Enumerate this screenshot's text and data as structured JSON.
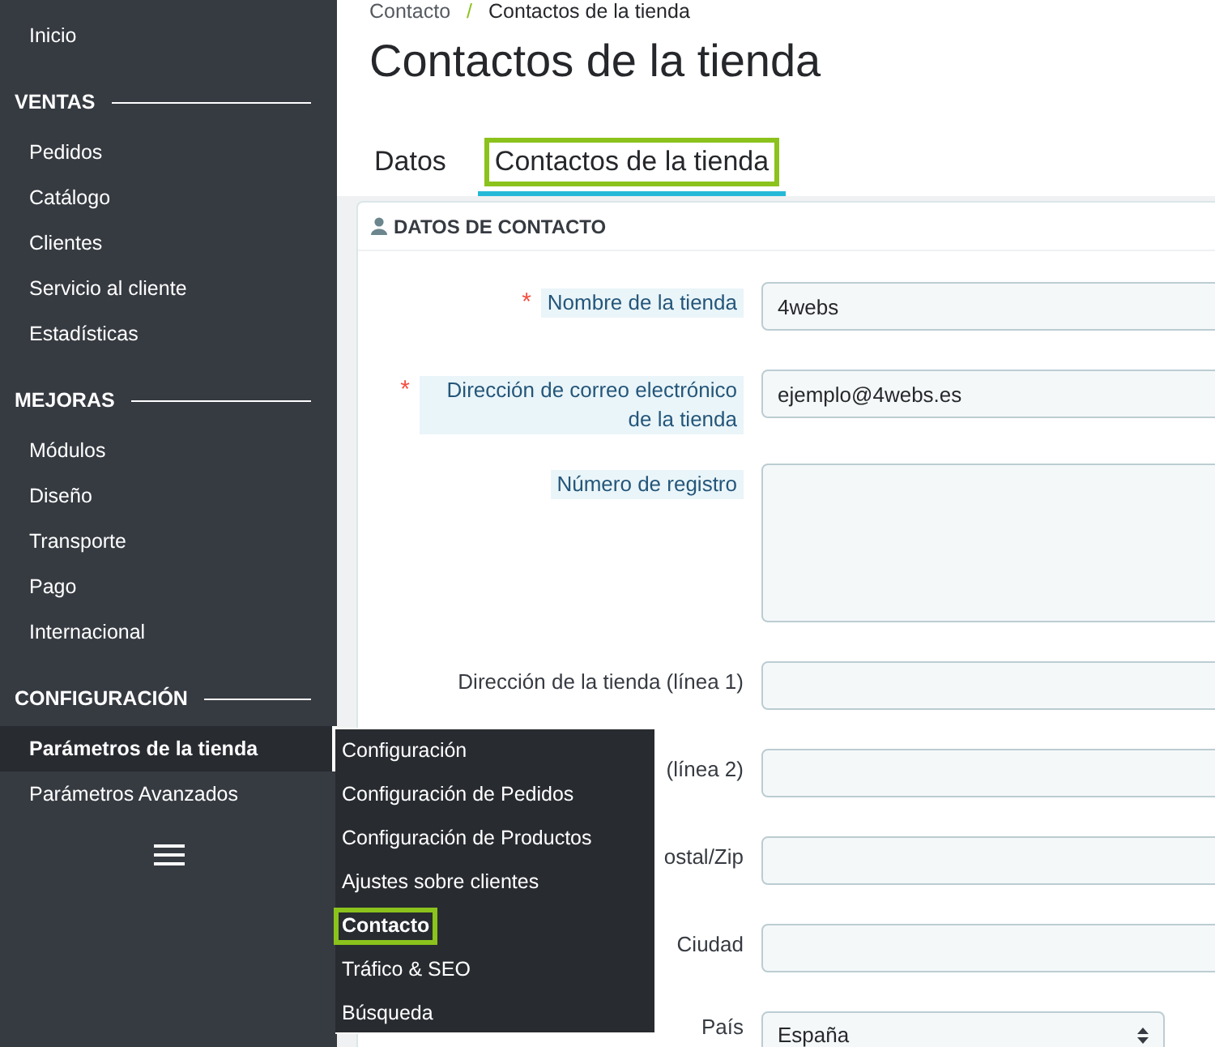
{
  "sidebar": {
    "items": [
      {
        "kind": "item",
        "label": "Inicio",
        "selected": false
      },
      {
        "kind": "heading",
        "label": "VENTAS"
      },
      {
        "kind": "item",
        "label": "Pedidos",
        "selected": false
      },
      {
        "kind": "item",
        "label": "Catálogo",
        "selected": false
      },
      {
        "kind": "item",
        "label": "Clientes",
        "selected": false
      },
      {
        "kind": "item",
        "label": "Servicio al cliente",
        "selected": false
      },
      {
        "kind": "item",
        "label": "Estadísticas",
        "selected": false
      },
      {
        "kind": "heading",
        "label": "MEJORAS"
      },
      {
        "kind": "item",
        "label": "Módulos",
        "selected": false
      },
      {
        "kind": "item",
        "label": "Diseño",
        "selected": false
      },
      {
        "kind": "item",
        "label": "Transporte",
        "selected": false
      },
      {
        "kind": "item",
        "label": "Pago",
        "selected": false
      },
      {
        "kind": "item",
        "label": "Internacional",
        "selected": false
      },
      {
        "kind": "heading",
        "label": "CONFIGURACIÓN"
      },
      {
        "kind": "item",
        "label": "Parámetros de la tienda",
        "selected": true
      },
      {
        "kind": "item",
        "label": "Parámetros Avanzados",
        "selected": false
      }
    ]
  },
  "flyout_menu": {
    "items": [
      {
        "label": "Configuración",
        "highlighted": false
      },
      {
        "label": "Configuración de Pedidos",
        "highlighted": false
      },
      {
        "label": "Configuración de Productos",
        "highlighted": false
      },
      {
        "label": "Ajustes sobre clientes",
        "highlighted": false
      },
      {
        "label": "Contacto",
        "highlighted": true
      },
      {
        "label": "Tráfico & SEO",
        "highlighted": false
      },
      {
        "label": "Búsqueda",
        "highlighted": false
      }
    ]
  },
  "breadcrumb": [
    "Contacto",
    "Contactos de la tienda"
  ],
  "breadcrumb_separator": "/",
  "title": "Contactos de la tienda",
  "tabs": [
    {
      "label": "Datos",
      "selected": false,
      "highlighted": false
    },
    {
      "label": "Contactos de la tienda",
      "selected": true,
      "highlighted": true
    }
  ],
  "panel": {
    "title": "DATOS DE CONTACTO",
    "fields": [
      {
        "kind": "input",
        "required_mark": "*",
        "label": "Nombre de la tienda",
        "help": true,
        "value": "4webs"
      },
      {
        "kind": "input",
        "required_mark": "*",
        "label": "Dirección de correo electrónico de la tienda",
        "help": true,
        "value": "ejemplo@4webs.es"
      },
      {
        "kind": "textarea",
        "label": "Número de registro",
        "help": true
      },
      {
        "kind": "input",
        "label": "Dirección de la tienda (línea 1)",
        "help": false
      },
      {
        "kind": "input",
        "label": "(línea 2)",
        "help": false
      },
      {
        "kind": "input",
        "label": "ostal/Zip",
        "help": false
      },
      {
        "kind": "input",
        "label": "Ciudad",
        "help": false
      },
      {
        "kind": "select",
        "label": "País",
        "help": false,
        "value": "España"
      }
    ]
  }
}
